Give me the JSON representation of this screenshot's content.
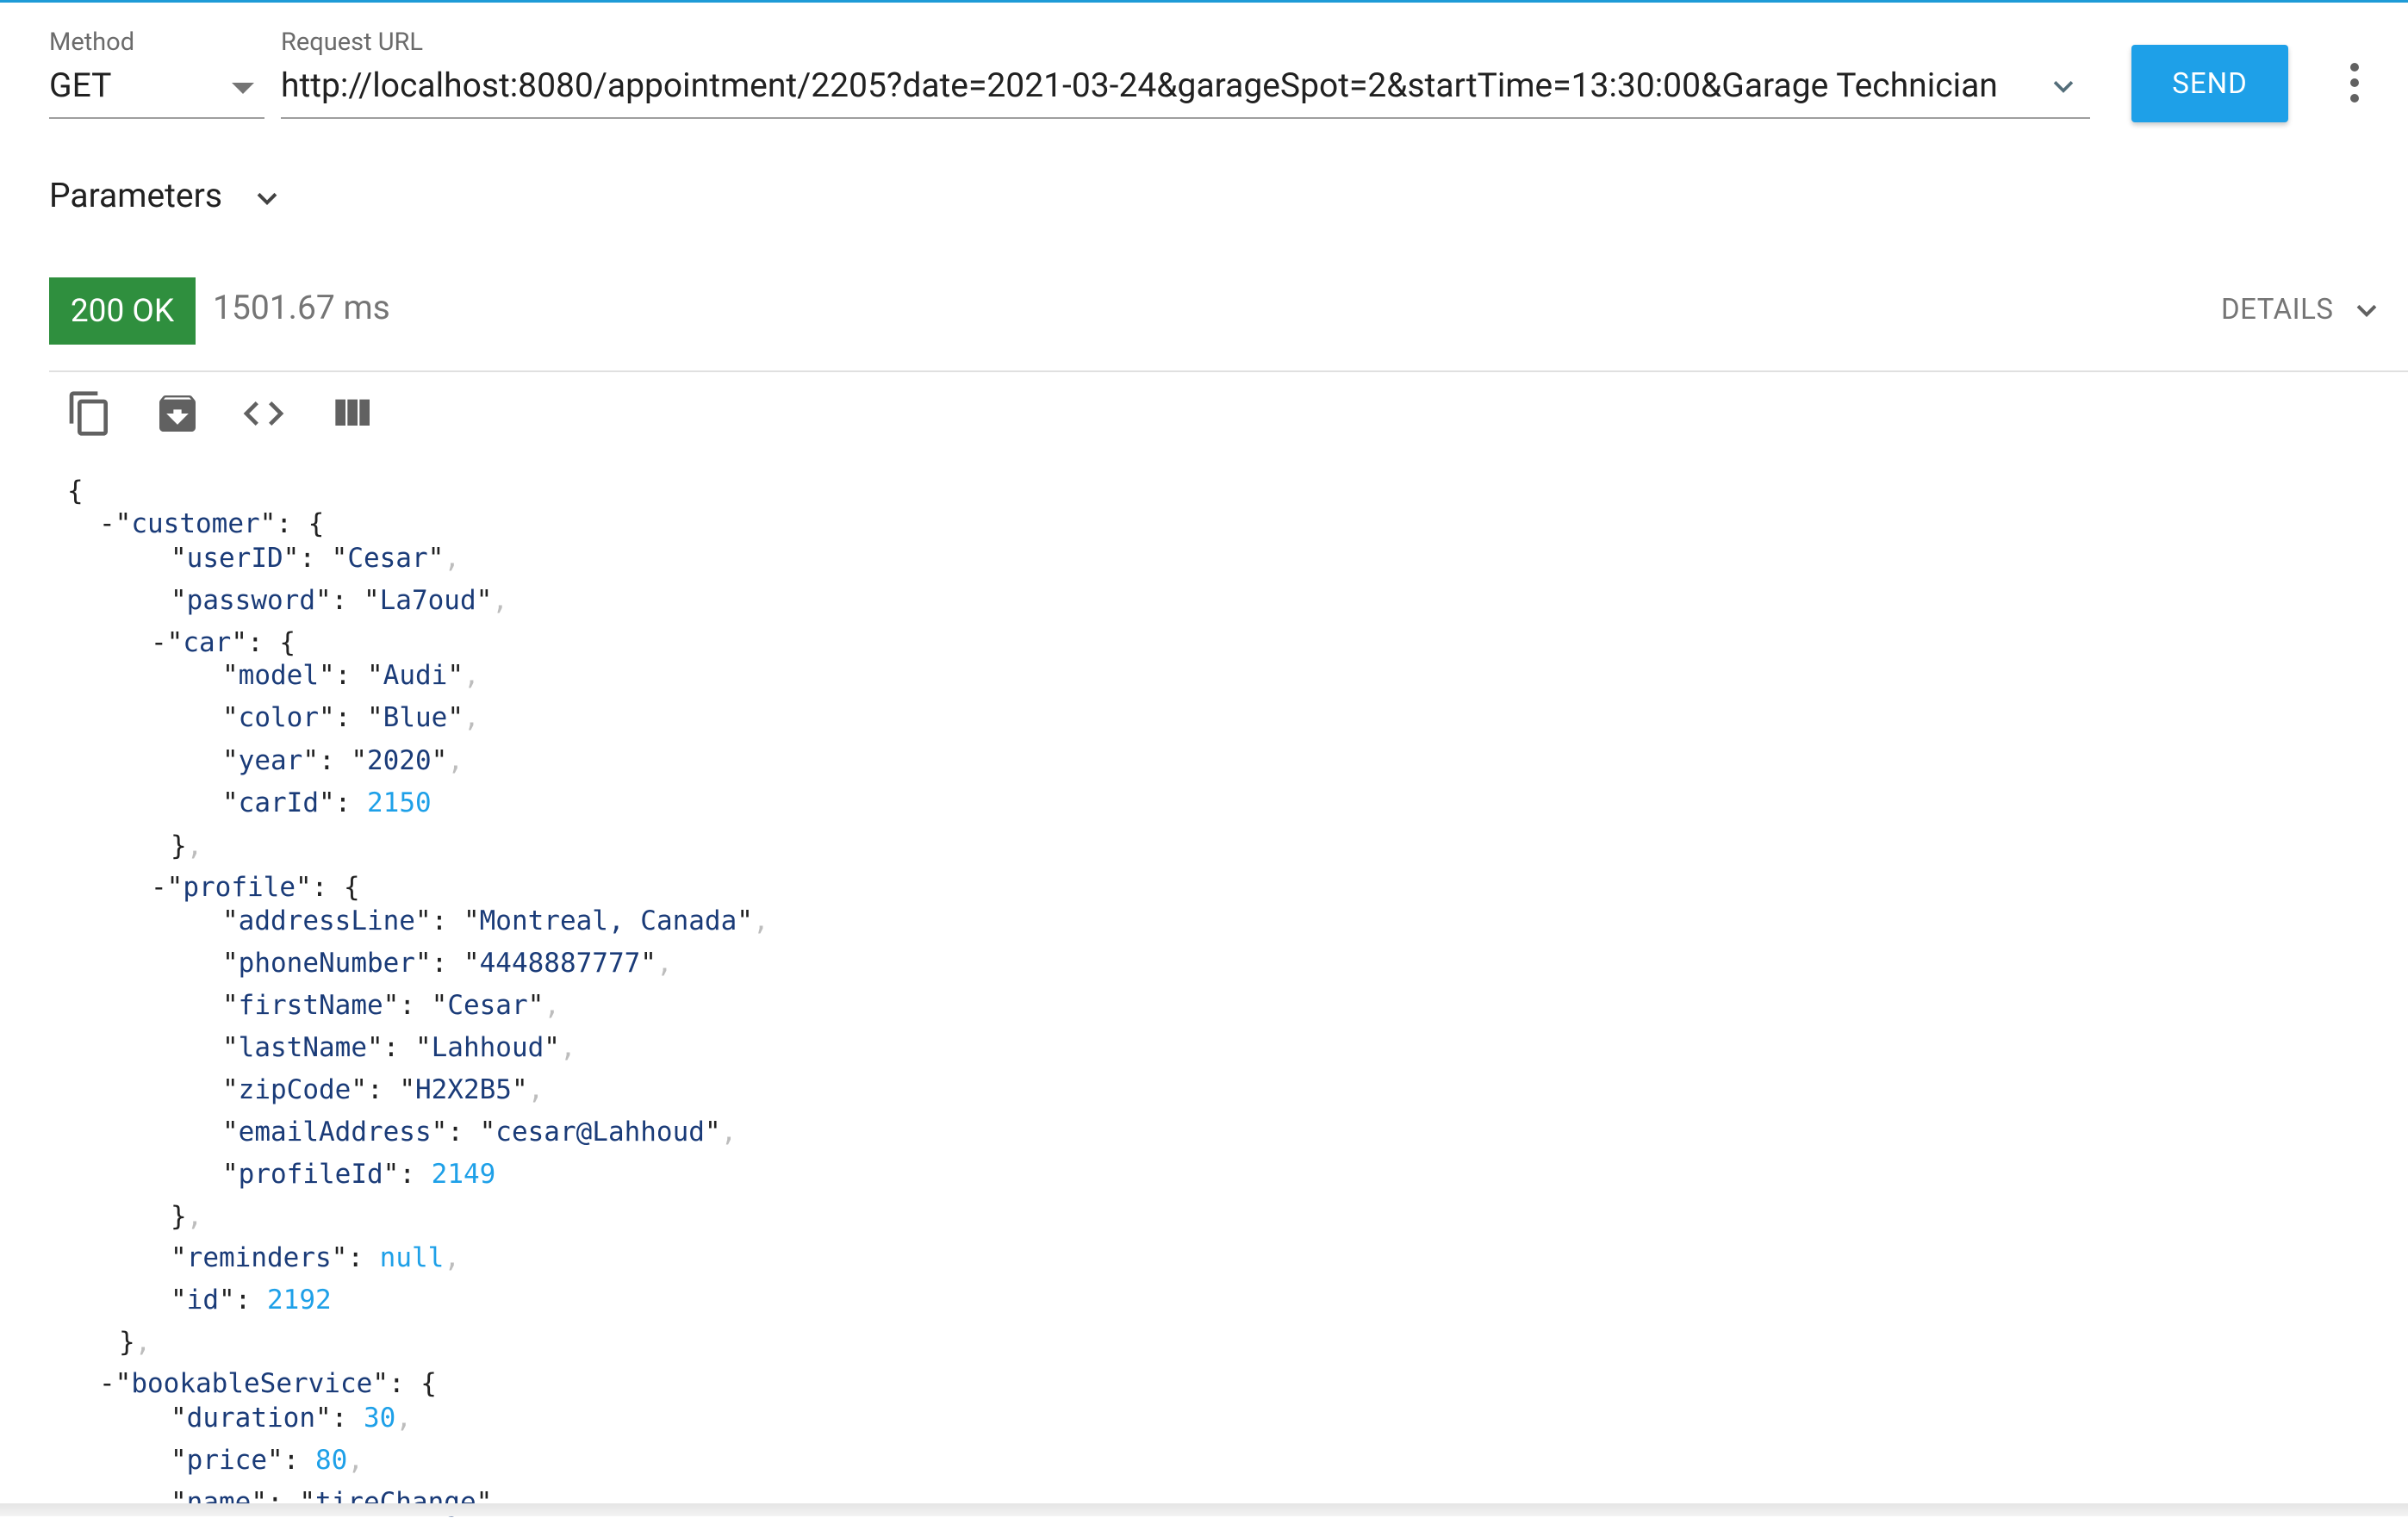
{
  "request": {
    "method_label": "Method",
    "method": "GET",
    "url_label": "Request URL",
    "url": "http://localhost:8080/appointment/2205?date=2021-03-24&garageSpot=2&startTime=13:30:00&Garage Technician",
    "send_label": "SEND",
    "parameters_label": "Parameters"
  },
  "response": {
    "status": "200 OK",
    "time": "1501.67 ms",
    "details_label": "DETAILS",
    "status_color": "#2f8f3e"
  },
  "toolbar": {
    "icons": [
      "copy-icon",
      "save-icon",
      "code-icon",
      "columns-icon"
    ]
  },
  "json_view": {
    "open_brace": "{",
    "customer_key": "customer",
    "userID_key": "userID",
    "userID_val": "Cesar",
    "password_key": "password",
    "password_val": "La7oud",
    "car_key": "car",
    "model_key": "model",
    "model_val": "Audi",
    "color_key": "color",
    "color_val": "Blue",
    "year_key": "year",
    "year_val": "2020",
    "carId_key": "carId",
    "carId_val": "2150",
    "profile_key": "profile",
    "addressLine_key": "addressLine",
    "addressLine_val": "Montreal, Canada",
    "phoneNumber_key": "phoneNumber",
    "phoneNumber_val": "4448887777",
    "firstName_key": "firstName",
    "firstName_val": "Cesar",
    "lastName_key": "lastName",
    "lastName_val": "Lahhoud",
    "zipCode_key": "zipCode",
    "zipCode_val": "H2X2B5",
    "emailAddress_key": "emailAddress",
    "emailAddress_val": "cesar@Lahhoud",
    "profileId_key": "profileId",
    "profileId_val": "2149",
    "reminders_key": "reminders",
    "reminders_val": "null",
    "id_key": "id",
    "id_val": "2192",
    "bookableService_key": "bookableService",
    "duration_key": "duration",
    "duration_val": "30",
    "price_key": "price",
    "price_val": "80",
    "name_key": "name",
    "name_val": "tireChange"
  },
  "colors": {
    "accent": "#1ea0e8",
    "json_key": "#1a3b78",
    "json_number": "#1ea0e8"
  }
}
